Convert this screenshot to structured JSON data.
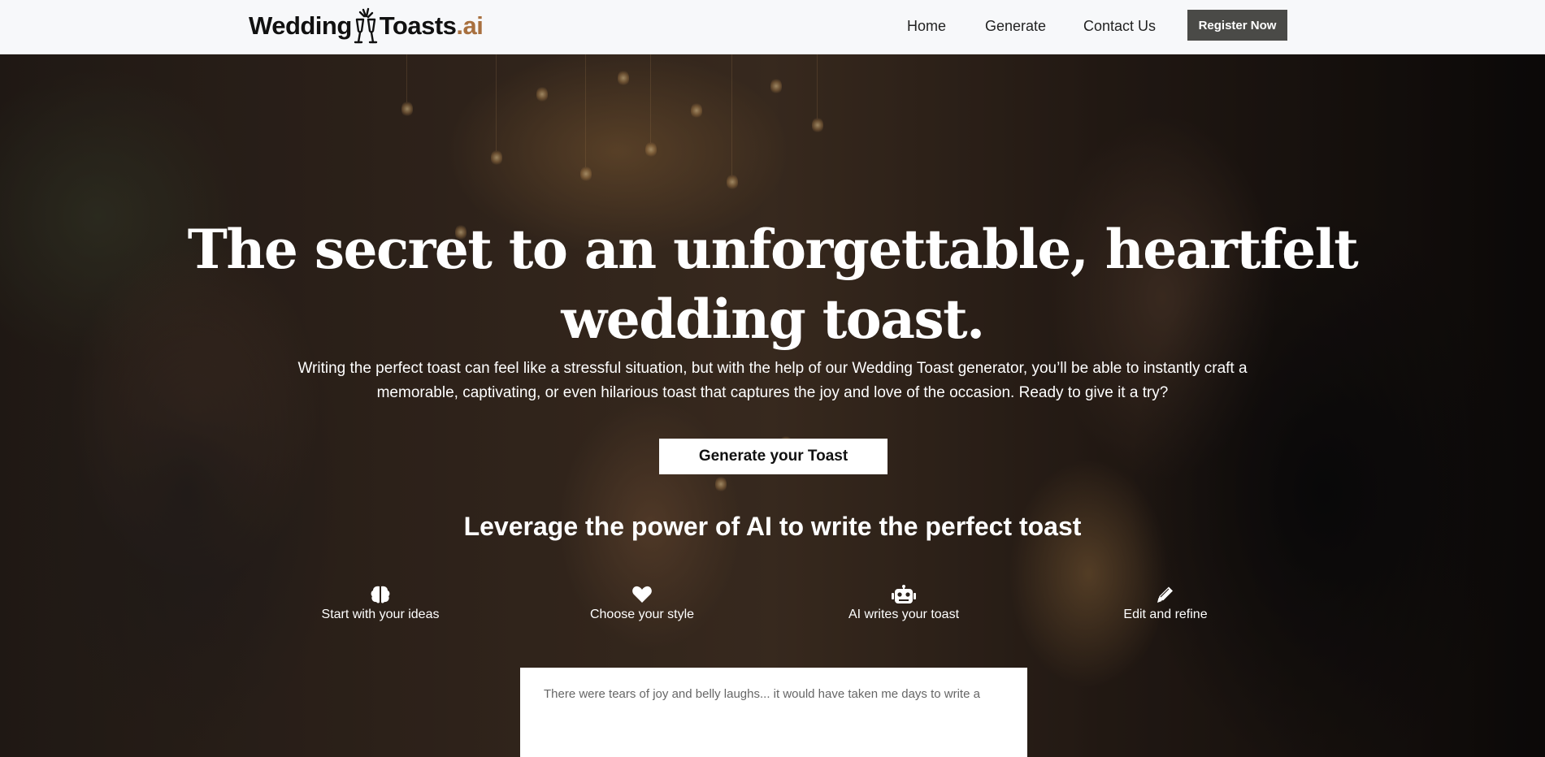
{
  "brand": {
    "name_part1": "Wedding",
    "name_part2": "Toasts",
    "name_suffix": ".ai",
    "accent_color": "#a8703f",
    "logo_icon": "champagne-glasses-icon"
  },
  "nav": {
    "links": [
      {
        "label": "Home"
      },
      {
        "label": "Generate"
      },
      {
        "label": "Contact Us"
      }
    ],
    "register_label": "Register Now"
  },
  "hero": {
    "headline_line1": "The secret to an unforgettable, heartfelt",
    "headline_line2": "wedding toast.",
    "subtext_line1": "Writing the perfect toast can feel like a stressful situation, but with the help of our Wedding Toast generator, you’ll be able to instantly craft a",
    "subtext_line2": "memorable, captivating, or even hilarious toast that captures the joy and love of the occasion. Ready to give it a try?",
    "cta_label": "Generate your Toast"
  },
  "features": {
    "title": "Leverage the power of AI to write the perfect toast",
    "items": [
      {
        "icon": "brain-icon",
        "label": "Start with your ideas"
      },
      {
        "icon": "heart-icon",
        "label": "Choose your style"
      },
      {
        "icon": "robot-icon",
        "label": "AI writes your toast"
      },
      {
        "icon": "pencil-icon",
        "label": "Edit and refine"
      }
    ]
  },
  "testimonial": {
    "text": "There were tears of joy and belly laughs... it would have taken me days to write a"
  }
}
